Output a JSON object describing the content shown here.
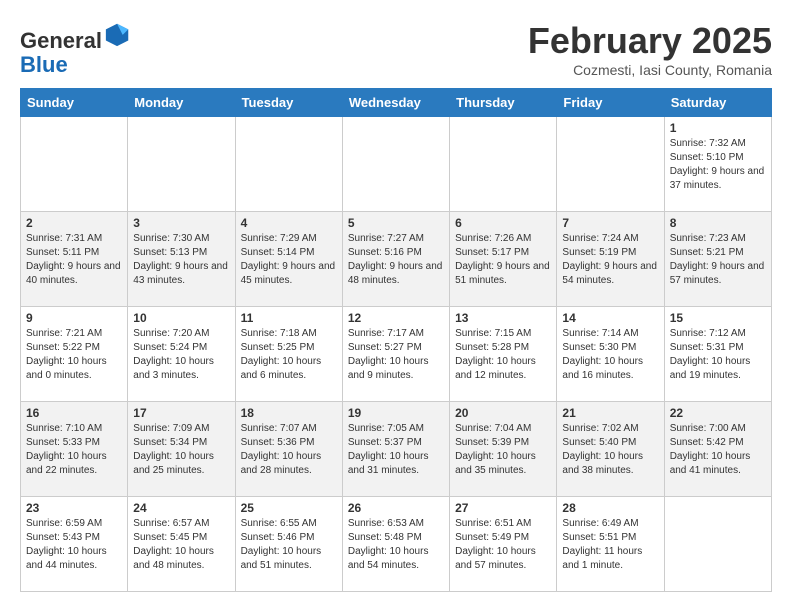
{
  "header": {
    "logo_general": "General",
    "logo_blue": "Blue",
    "month_title": "February 2025",
    "subtitle": "Cozmesti, Iasi County, Romania"
  },
  "days_of_week": [
    "Sunday",
    "Monday",
    "Tuesday",
    "Wednesday",
    "Thursday",
    "Friday",
    "Saturday"
  ],
  "weeks": [
    [
      {
        "day": "",
        "info": ""
      },
      {
        "day": "",
        "info": ""
      },
      {
        "day": "",
        "info": ""
      },
      {
        "day": "",
        "info": ""
      },
      {
        "day": "",
        "info": ""
      },
      {
        "day": "",
        "info": ""
      },
      {
        "day": "1",
        "info": "Sunrise: 7:32 AM\nSunset: 5:10 PM\nDaylight: 9 hours and 37 minutes."
      }
    ],
    [
      {
        "day": "2",
        "info": "Sunrise: 7:31 AM\nSunset: 5:11 PM\nDaylight: 9 hours and 40 minutes."
      },
      {
        "day": "3",
        "info": "Sunrise: 7:30 AM\nSunset: 5:13 PM\nDaylight: 9 hours and 43 minutes."
      },
      {
        "day": "4",
        "info": "Sunrise: 7:29 AM\nSunset: 5:14 PM\nDaylight: 9 hours and 45 minutes."
      },
      {
        "day": "5",
        "info": "Sunrise: 7:27 AM\nSunset: 5:16 PM\nDaylight: 9 hours and 48 minutes."
      },
      {
        "day": "6",
        "info": "Sunrise: 7:26 AM\nSunset: 5:17 PM\nDaylight: 9 hours and 51 minutes."
      },
      {
        "day": "7",
        "info": "Sunrise: 7:24 AM\nSunset: 5:19 PM\nDaylight: 9 hours and 54 minutes."
      },
      {
        "day": "8",
        "info": "Sunrise: 7:23 AM\nSunset: 5:21 PM\nDaylight: 9 hours and 57 minutes."
      }
    ],
    [
      {
        "day": "9",
        "info": "Sunrise: 7:21 AM\nSunset: 5:22 PM\nDaylight: 10 hours and 0 minutes."
      },
      {
        "day": "10",
        "info": "Sunrise: 7:20 AM\nSunset: 5:24 PM\nDaylight: 10 hours and 3 minutes."
      },
      {
        "day": "11",
        "info": "Sunrise: 7:18 AM\nSunset: 5:25 PM\nDaylight: 10 hours and 6 minutes."
      },
      {
        "day": "12",
        "info": "Sunrise: 7:17 AM\nSunset: 5:27 PM\nDaylight: 10 hours and 9 minutes."
      },
      {
        "day": "13",
        "info": "Sunrise: 7:15 AM\nSunset: 5:28 PM\nDaylight: 10 hours and 12 minutes."
      },
      {
        "day": "14",
        "info": "Sunrise: 7:14 AM\nSunset: 5:30 PM\nDaylight: 10 hours and 16 minutes."
      },
      {
        "day": "15",
        "info": "Sunrise: 7:12 AM\nSunset: 5:31 PM\nDaylight: 10 hours and 19 minutes."
      }
    ],
    [
      {
        "day": "16",
        "info": "Sunrise: 7:10 AM\nSunset: 5:33 PM\nDaylight: 10 hours and 22 minutes."
      },
      {
        "day": "17",
        "info": "Sunrise: 7:09 AM\nSunset: 5:34 PM\nDaylight: 10 hours and 25 minutes."
      },
      {
        "day": "18",
        "info": "Sunrise: 7:07 AM\nSunset: 5:36 PM\nDaylight: 10 hours and 28 minutes."
      },
      {
        "day": "19",
        "info": "Sunrise: 7:05 AM\nSunset: 5:37 PM\nDaylight: 10 hours and 31 minutes."
      },
      {
        "day": "20",
        "info": "Sunrise: 7:04 AM\nSunset: 5:39 PM\nDaylight: 10 hours and 35 minutes."
      },
      {
        "day": "21",
        "info": "Sunrise: 7:02 AM\nSunset: 5:40 PM\nDaylight: 10 hours and 38 minutes."
      },
      {
        "day": "22",
        "info": "Sunrise: 7:00 AM\nSunset: 5:42 PM\nDaylight: 10 hours and 41 minutes."
      }
    ],
    [
      {
        "day": "23",
        "info": "Sunrise: 6:59 AM\nSunset: 5:43 PM\nDaylight: 10 hours and 44 minutes."
      },
      {
        "day": "24",
        "info": "Sunrise: 6:57 AM\nSunset: 5:45 PM\nDaylight: 10 hours and 48 minutes."
      },
      {
        "day": "25",
        "info": "Sunrise: 6:55 AM\nSunset: 5:46 PM\nDaylight: 10 hours and 51 minutes."
      },
      {
        "day": "26",
        "info": "Sunrise: 6:53 AM\nSunset: 5:48 PM\nDaylight: 10 hours and 54 minutes."
      },
      {
        "day": "27",
        "info": "Sunrise: 6:51 AM\nSunset: 5:49 PM\nDaylight: 10 hours and 57 minutes."
      },
      {
        "day": "28",
        "info": "Sunrise: 6:49 AM\nSunset: 5:51 PM\nDaylight: 11 hours and 1 minute."
      },
      {
        "day": "",
        "info": ""
      }
    ]
  ]
}
